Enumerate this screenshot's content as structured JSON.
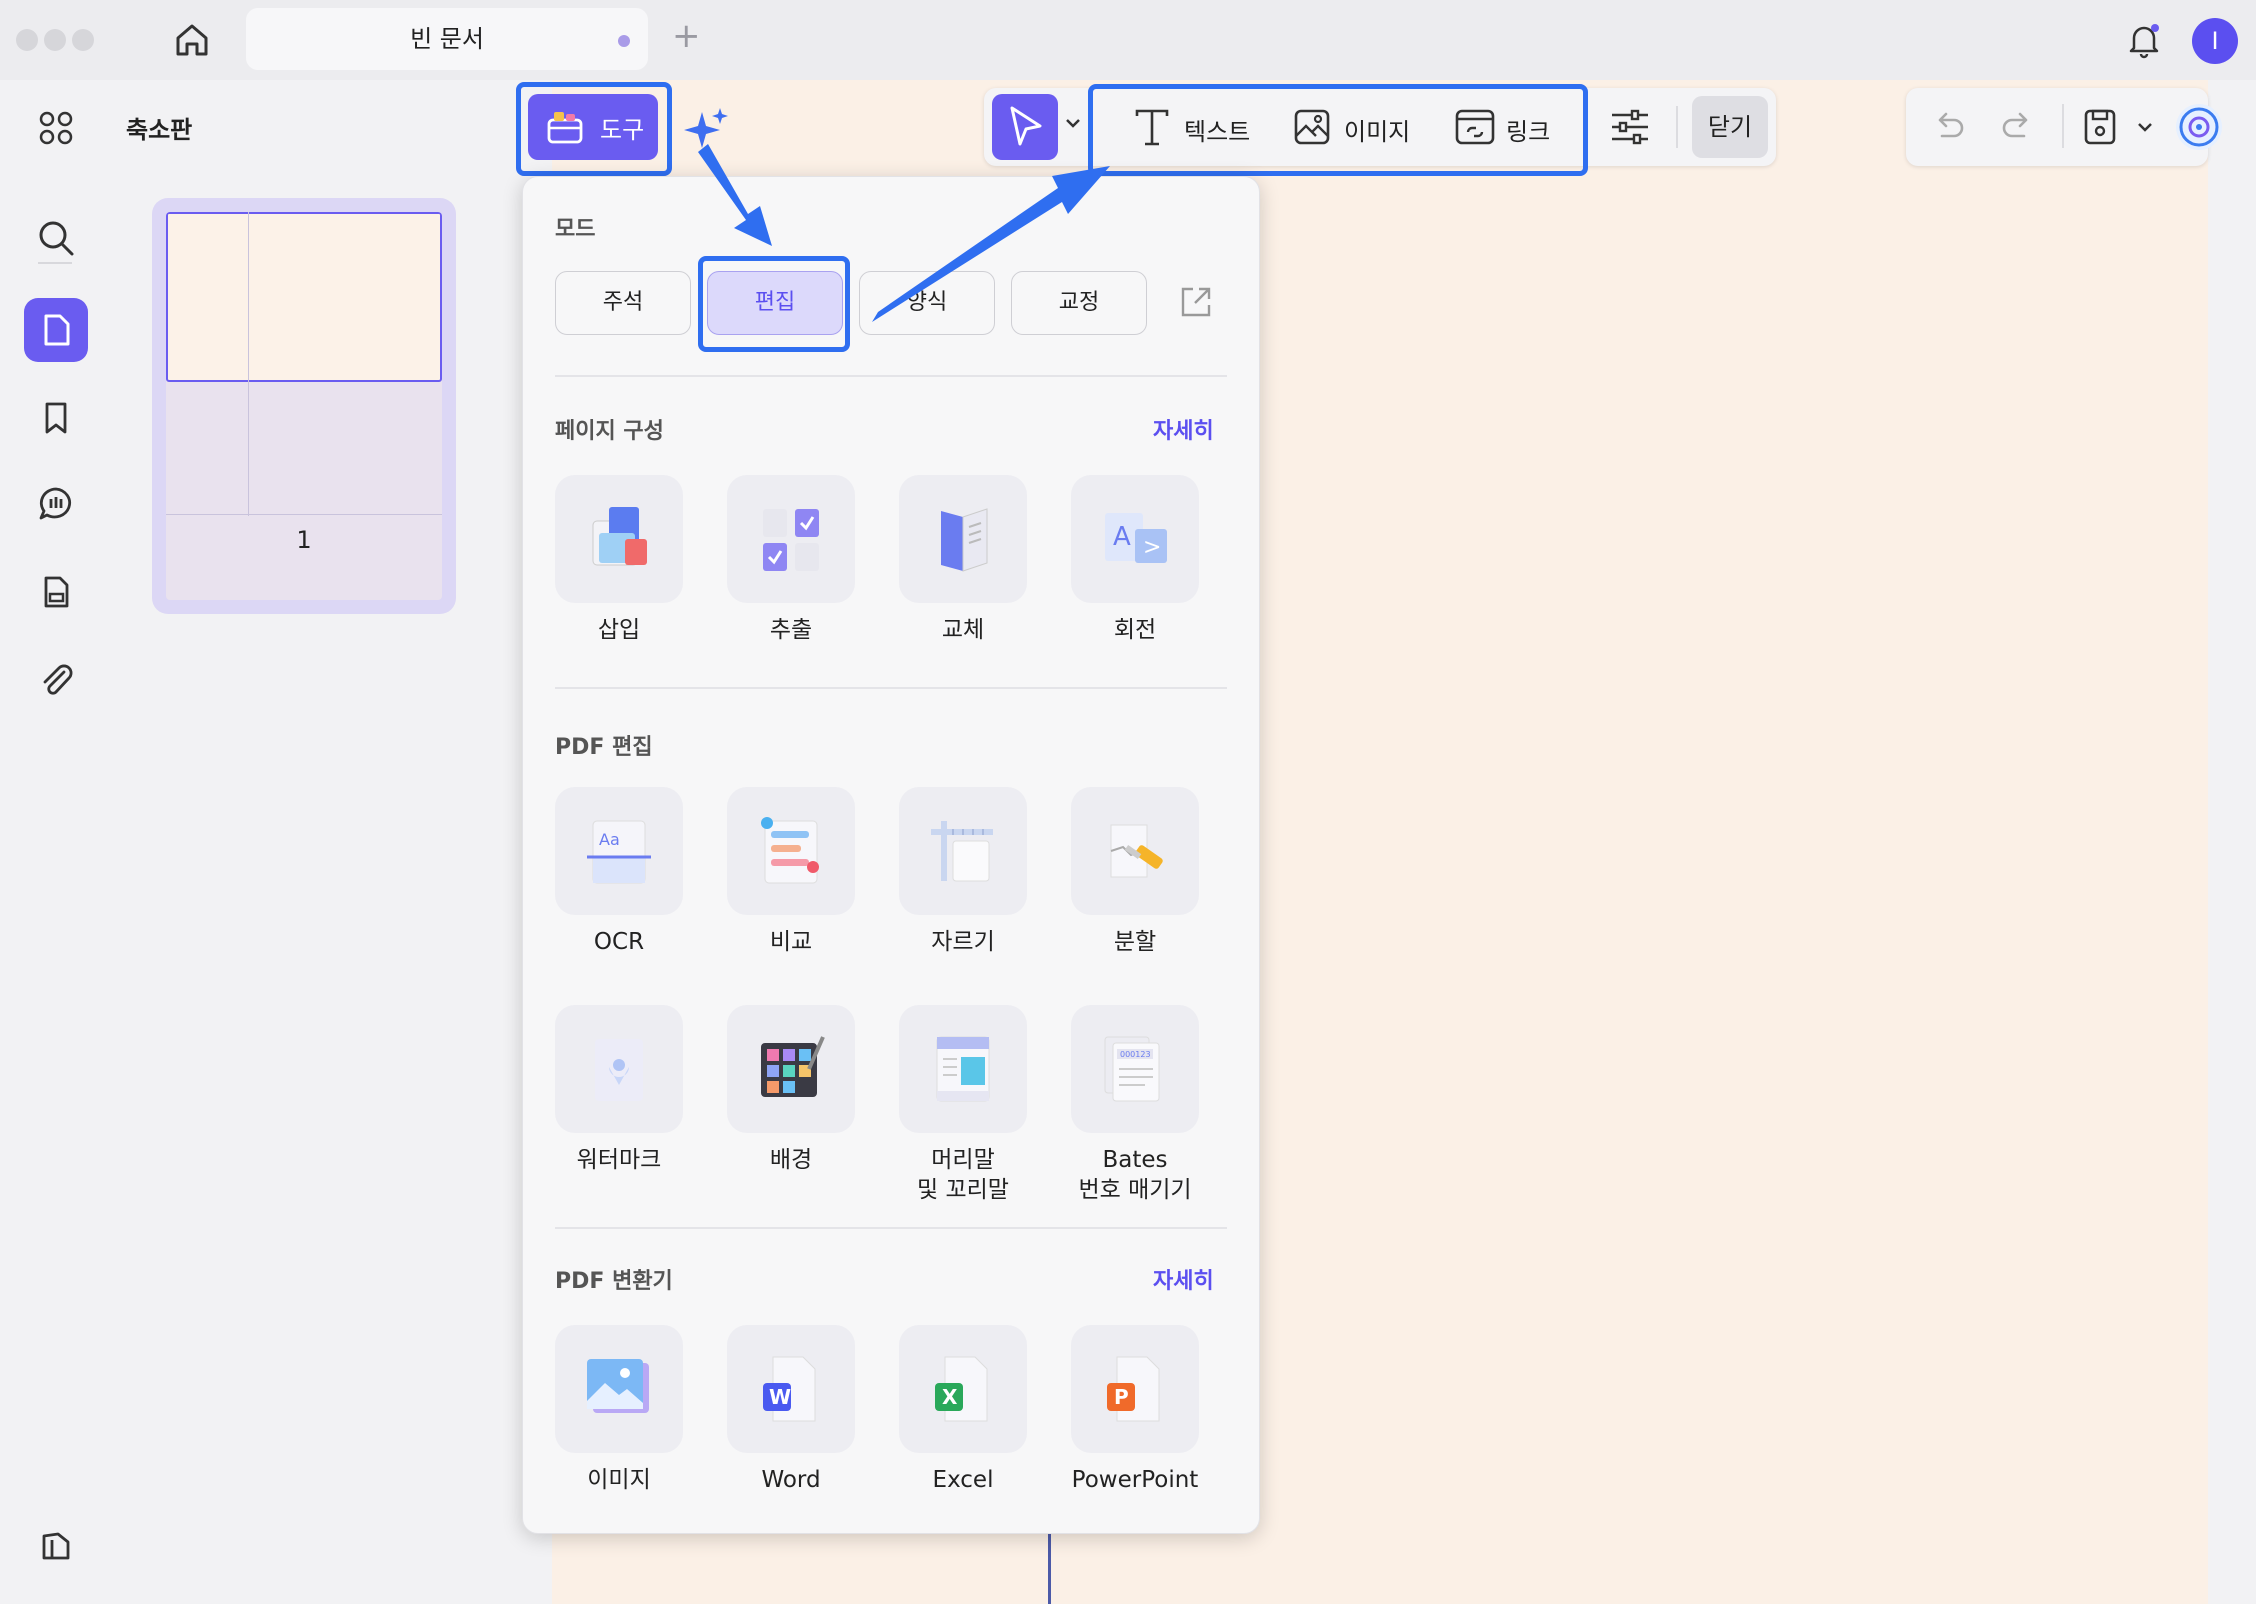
{
  "window": {
    "tab_title": "빈 문서",
    "avatar_initial": "I"
  },
  "thumbnails": {
    "title": "축소판",
    "page_label": "1"
  },
  "toolbar": {
    "tools_label": "도구",
    "text_label": "텍스트",
    "image_label": "이미지",
    "link_label": "링크",
    "close_label": "닫기"
  },
  "dropdown": {
    "mode_title": "모드",
    "modes": [
      {
        "label": "주석"
      },
      {
        "label": "편집"
      },
      {
        "label": "양식"
      },
      {
        "label": "교정"
      }
    ],
    "page_section": {
      "title": "페이지 구성",
      "more": "자세히",
      "items": [
        {
          "label": "삽입",
          "icon": "insert-pages-icon"
        },
        {
          "label": "추출",
          "icon": "extract-pages-icon"
        },
        {
          "label": "교체",
          "icon": "replace-pages-icon"
        },
        {
          "label": "회전",
          "icon": "rotate-pages-icon"
        }
      ]
    },
    "edit_section": {
      "title": "PDF 편집",
      "items": [
        {
          "label": "OCR",
          "icon": "ocr-icon"
        },
        {
          "label": "비교",
          "icon": "compare-icon"
        },
        {
          "label": "자르기",
          "icon": "crop-icon"
        },
        {
          "label": "분할",
          "icon": "split-icon"
        },
        {
          "label": "워터마크",
          "icon": "watermark-icon"
        },
        {
          "label": "배경",
          "icon": "background-icon"
        },
        {
          "label_line1": "머리말",
          "label_line2": "및 꼬리말",
          "icon": "header-footer-icon"
        },
        {
          "label_line1": "Bates",
          "label_line2": "번호 매기기",
          "icon": "bates-numbering-icon"
        }
      ]
    },
    "convert_section": {
      "title": "PDF 변환기",
      "more": "자세히",
      "items": [
        {
          "label": "이미지",
          "icon": "convert-image-icon"
        },
        {
          "label": "Word",
          "icon": "word-icon",
          "letter": "W"
        },
        {
          "label": "Excel",
          "icon": "excel-icon",
          "letter": "X"
        },
        {
          "label": "PowerPoint",
          "icon": "powerpoint-icon",
          "letter": "P"
        }
      ]
    }
  },
  "colors": {
    "accent": "#6a5cf0",
    "highlight": "#2f6ef0",
    "page_bg": "#fbf0e6"
  }
}
